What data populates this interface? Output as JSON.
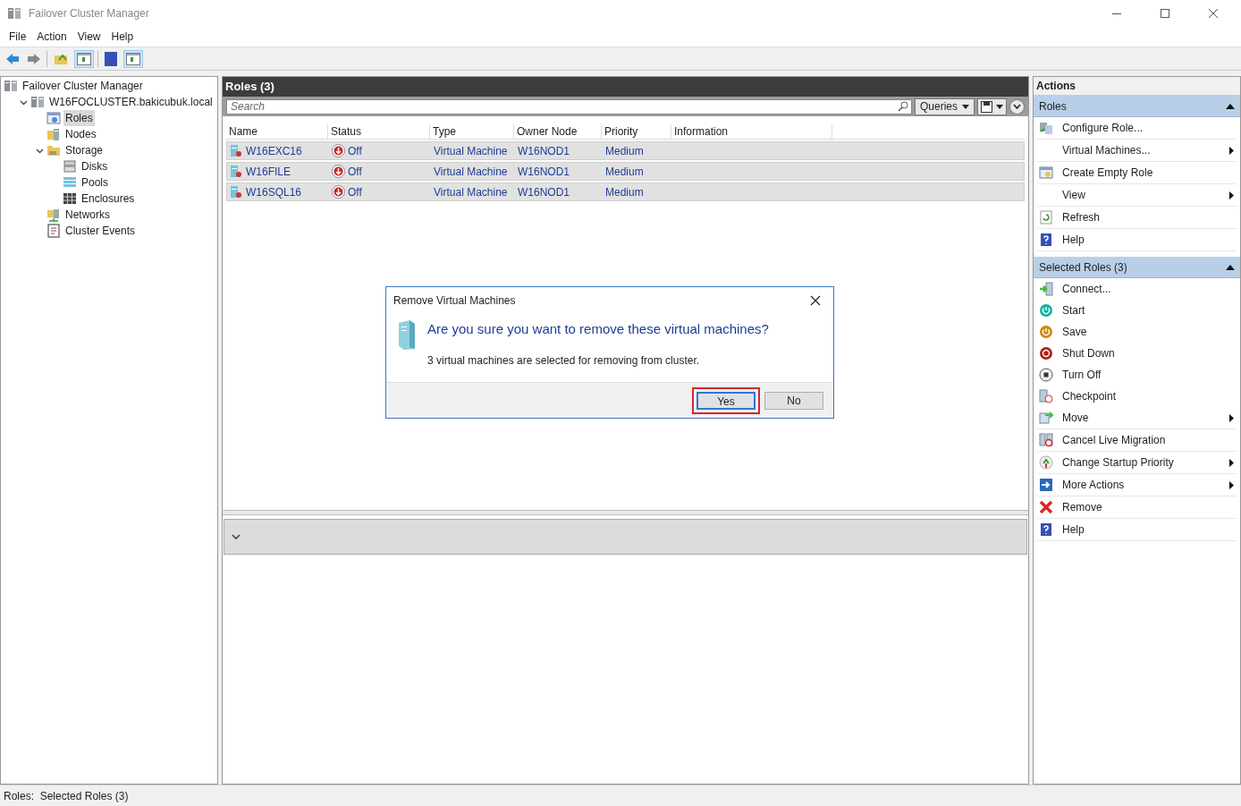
{
  "window": {
    "title": "Failover Cluster Manager"
  },
  "menu": [
    "File",
    "Action",
    "View",
    "Help"
  ],
  "tree": [
    {
      "label": "Failover Cluster Manager",
      "selected": false,
      "children": [
        {
          "label": "W16FOCLUSTER.bakicubuk.local",
          "selected": false,
          "expanded": true,
          "children": [
            {
              "label": "Roles",
              "selected": true
            },
            {
              "label": "Nodes",
              "selected": false
            },
            {
              "label": "Storage",
              "selected": false,
              "expanded": true,
              "children": [
                {
                  "label": "Disks",
                  "selected": false
                },
                {
                  "label": "Pools",
                  "selected": false
                },
                {
                  "label": "Enclosures",
                  "selected": false
                }
              ]
            },
            {
              "label": "Networks",
              "selected": false
            },
            {
              "label": "Cluster Events",
              "selected": false
            }
          ]
        }
      ]
    }
  ],
  "roles_panel": {
    "title": "Roles (3)",
    "search": {
      "placeholder": "Search"
    },
    "queries": "Queries",
    "columns": [
      "Name",
      "Status",
      "Type",
      "Owner Node",
      "Priority",
      "Information"
    ],
    "rows": [
      {
        "name": "W16EXC16",
        "status": "Off",
        "type": "Virtual Machine",
        "owner_node": "W16NOD1",
        "priority": "Medium",
        "selected": true
      },
      {
        "name": "W16FILE",
        "status": "Off",
        "type": "Virtual Machine",
        "owner_node": "W16NOD1",
        "priority": "Medium",
        "selected": true
      },
      {
        "name": "W16SQL16",
        "status": "Off",
        "type": "Virtual Machine",
        "owner_node": "W16NOD1",
        "priority": "Medium",
        "selected": true
      }
    ]
  },
  "dialog": {
    "title": "Remove Virtual Machines",
    "heading": "Are you sure you want to remove these virtual machines?",
    "message": "3 virtual machines are selected for removing from cluster.",
    "buttons": [
      {
        "label": "Yes",
        "selected": true
      },
      {
        "label": "No",
        "selected": false
      }
    ]
  },
  "actions": {
    "title": "Actions",
    "sections": [
      {
        "title": "Roles",
        "expanded": true,
        "items": [
          {
            "label": "Configure Role...",
            "submenu": false
          },
          {
            "label": "Virtual Machines...",
            "submenu": true
          },
          {
            "label": "Create Empty Role",
            "submenu": false
          },
          {
            "label": "View",
            "submenu": true
          },
          {
            "label": "Refresh",
            "submenu": false
          },
          {
            "label": "Help",
            "submenu": false
          }
        ]
      },
      {
        "title": "Selected Roles (3)",
        "expanded": true,
        "items": [
          {
            "label": "Connect...",
            "submenu": false
          },
          {
            "label": "Start",
            "submenu": false
          },
          {
            "label": "Save",
            "submenu": false
          },
          {
            "label": "Shut Down",
            "submenu": false
          },
          {
            "label": "Turn Off",
            "submenu": false
          },
          {
            "label": "Checkpoint",
            "submenu": false
          },
          {
            "label": "Move",
            "submenu": true
          },
          {
            "label": "Cancel Live Migration",
            "submenu": false
          },
          {
            "label": "Change Startup Priority",
            "submenu": true
          },
          {
            "label": "More Actions",
            "submenu": true
          },
          {
            "label": "Remove",
            "submenu": false
          },
          {
            "label": "Help",
            "submenu": false
          }
        ]
      }
    ]
  },
  "status_bar": "Roles:  Selected Roles (3)"
}
